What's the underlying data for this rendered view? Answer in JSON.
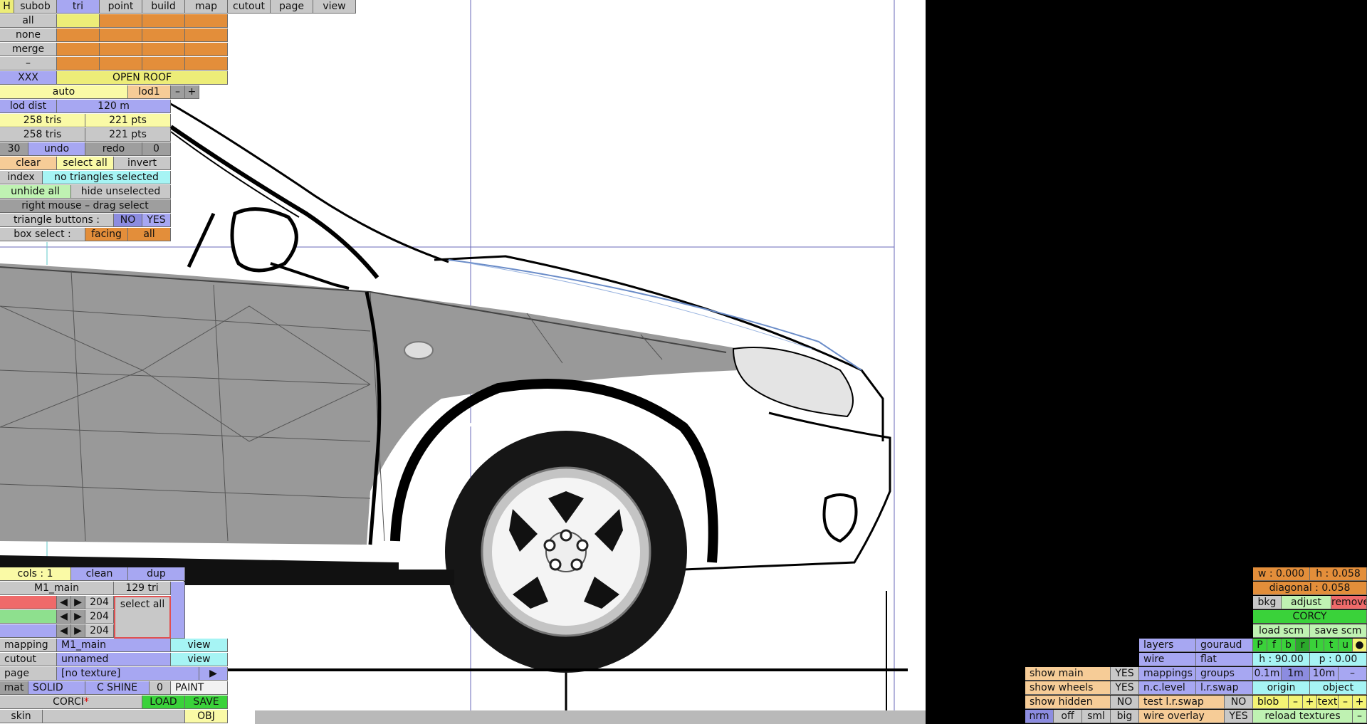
{
  "tabs": [
    "H",
    "subob",
    "tri",
    "point",
    "build",
    "map",
    "cutout",
    "page",
    "view"
  ],
  "sel_rows": [
    "all",
    "none",
    "merge",
    "–"
  ],
  "xxx": "XXX",
  "open_roof": "OPEN ROOF",
  "lod": {
    "auto": "auto",
    "name": "lod1",
    "minus": "–",
    "plus": "+",
    "dist_label": "lod dist",
    "dist_value": "120 m"
  },
  "stats": {
    "tris1": "258 tris",
    "pts1": "221 pts",
    "tris2": "258 tris",
    "pts2": "221 pts"
  },
  "undo": {
    "count": "30",
    "undo": "undo",
    "redo": "redo",
    "redo_count": "0"
  },
  "sel_actions": {
    "clear": "clear",
    "select_all": "select all",
    "invert": "invert"
  },
  "index": {
    "label": "index",
    "status": "no triangles selected"
  },
  "hide": {
    "unhide": "unhide all",
    "hide_unsel": "hide unselected"
  },
  "drag_hint": "right mouse – drag select",
  "tri_buttons": {
    "label": "triangle buttons :",
    "no": "NO",
    "yes": "YES"
  },
  "box_select": {
    "label": "box select :",
    "facing": "facing",
    "all": "all"
  },
  "cols": {
    "label": "cols : 1",
    "clean": "clean",
    "dup": "dup"
  },
  "material": {
    "name": "M1_main",
    "tri_count": "129 tri",
    "r": "204",
    "g": "204",
    "b": "204",
    "select_all": "select all",
    "arrow_left": "◀",
    "arrow_right": "▶"
  },
  "mapping": {
    "label": "mapping",
    "value": "M1_main",
    "view": "view"
  },
  "cutout": {
    "label": "cutout",
    "value": "unnamed",
    "view": "view"
  },
  "page": {
    "label": "page",
    "value": "[no texture]",
    "arrow": "▶"
  },
  "mat_row": {
    "mat": "mat",
    "solid": "SOLID",
    "shine": "C SHINE",
    "num": "0",
    "paint": "PAINT"
  },
  "file": {
    "name": "CORCI",
    "star": "*",
    "load": "LOAD",
    "save": "SAVE"
  },
  "skin": {
    "label": "skin",
    "obj": "OBJ"
  },
  "right": {
    "w": "w : 0.000",
    "h": "h : 0.058",
    "diagonal": "diagonal : 0.058",
    "bkg": "bkg",
    "adjust": "adjust",
    "remove": "remove",
    "name": "CORCY",
    "load_scm": "load scm",
    "save_scm": "save scm",
    "views": [
      "P",
      "f",
      "b",
      "r",
      "l",
      "t",
      "u",
      "●"
    ],
    "layers": "layers",
    "gouraud": "gouraud",
    "heading": "h : 90.00",
    "pitch": "p : 0.00",
    "wire": "wire",
    "flat": "flat",
    "show_main": "show main",
    "show_main_val": "YES",
    "mappings": "mappings",
    "groups": "groups",
    "grid": [
      "0.1m",
      "1m",
      "10m",
      "–"
    ],
    "show_wheels": "show wheels",
    "show_wheels_val": "YES",
    "nc_level": "n.c.level",
    "lr_swap": "l.r.swap",
    "origin": "origin",
    "object": "object",
    "show_hidden": "show hidden",
    "show_hidden_val": "NO",
    "test_lr": "test l.r.swap",
    "test_lr_val": "NO",
    "blob": "blob",
    "blob_minus": "–",
    "blob_plus": "+",
    "text": "text",
    "text_minus": "–",
    "text_plus": "+",
    "nrm": "nrm",
    "off": "off",
    "sml": "sml",
    "big": "big",
    "wire_overlay": "wire overlay",
    "wire_overlay_val": "YES",
    "reload": "reload textures",
    "reload_minus": "–"
  },
  "colors": {
    "panel_blue": "#a7a7f2",
    "panel_orange": "#e38e3a",
    "panel_yellow": "#fafaa6",
    "panel_green": "#3ad23a"
  }
}
